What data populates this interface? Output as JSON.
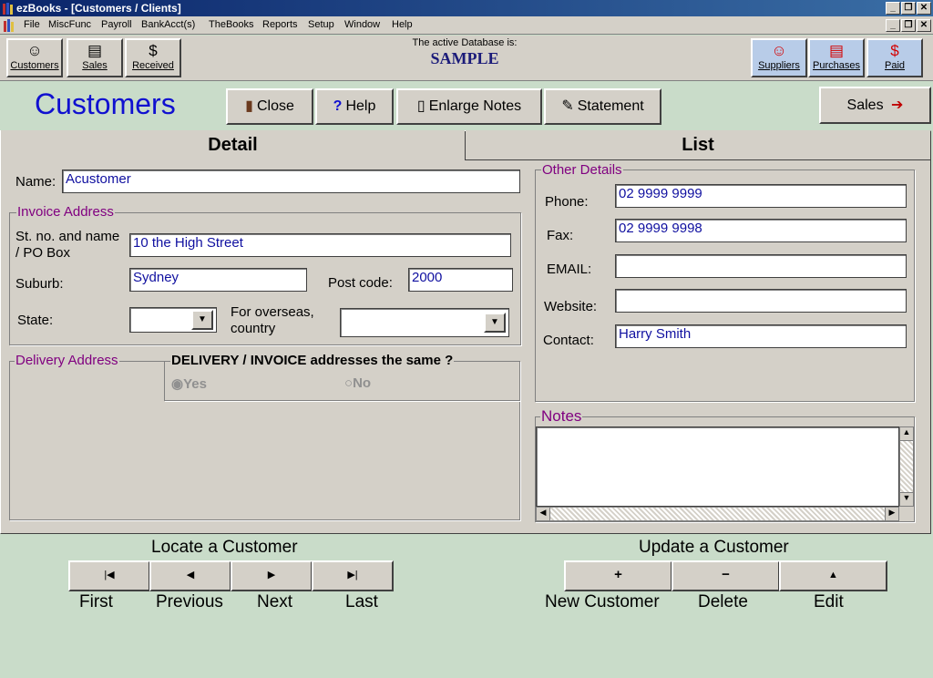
{
  "window": {
    "title": "ezBooks - [Customers / Clients]"
  },
  "menubar": {
    "items": [
      "File",
      "MiscFunc",
      "Payroll",
      "BankAcct(s)",
      "TheBooks",
      "Reports",
      "Setup",
      "Window",
      "Help"
    ]
  },
  "toolbar": {
    "left": [
      {
        "label": "Customers",
        "icon": "smiley-icon"
      },
      {
        "label": "Sales",
        "icon": "document-stack-icon"
      },
      {
        "label": "Received",
        "icon": "dollar-icon"
      }
    ],
    "right": [
      {
        "label": "Suppliers",
        "icon": "smiley-icon"
      },
      {
        "label": "Purchases",
        "icon": "document-stack-icon"
      },
      {
        "label": "Paid",
        "icon": "dollar-icon"
      }
    ],
    "db_caption": "The active Database is:",
    "db_name": "SAMPLE"
  },
  "header": {
    "title": "Customers",
    "buttons": {
      "close": "Close",
      "help": "Help",
      "enlarge_notes": "Enlarge Notes",
      "statement": "Statement",
      "sales": "Sales"
    }
  },
  "tabs": {
    "detail": "Detail",
    "list": "List"
  },
  "form": {
    "name_label": "Name:",
    "name_value": "Acustomer",
    "invoice_group": "Invoice Address",
    "street_label": "St. no. and name / PO Box",
    "street_value": "10 the High Street",
    "suburb_label": "Suburb:",
    "suburb_value": "Sydney",
    "postcode_label": "Post code:",
    "postcode_value": "2000",
    "state_label": "State:",
    "state_value": "",
    "country_label": "For overseas, country",
    "country_value": "",
    "delivery_group": "Delivery Address",
    "same_question": "DELIVERY / INVOICE addresses the same ?",
    "yes": "Yes",
    "no": "No"
  },
  "other": {
    "group": "Other Details",
    "phone_label": "Phone:",
    "phone_value": "02 9999 9999",
    "fax_label": "Fax:",
    "fax_value": "02 9999 9998",
    "email_label": "EMAIL:",
    "email_value": "",
    "website_label": "Website:",
    "website_value": "",
    "contact_label": "Contact:",
    "contact_value": "Harry Smith",
    "notes_label": "Notes",
    "notes_value": ""
  },
  "locate": {
    "title": "Locate a Customer",
    "first": "First",
    "previous": "Previous",
    "next": "Next",
    "last": "Last"
  },
  "update": {
    "title": "Update a Customer",
    "new": "New Customer",
    "delete": "Delete",
    "edit": "Edit"
  },
  "colors": {
    "accent_blue": "#1010d0",
    "group_purple": "#800080",
    "field_text": "#1010a0",
    "background_green": "#c9dcc9"
  }
}
